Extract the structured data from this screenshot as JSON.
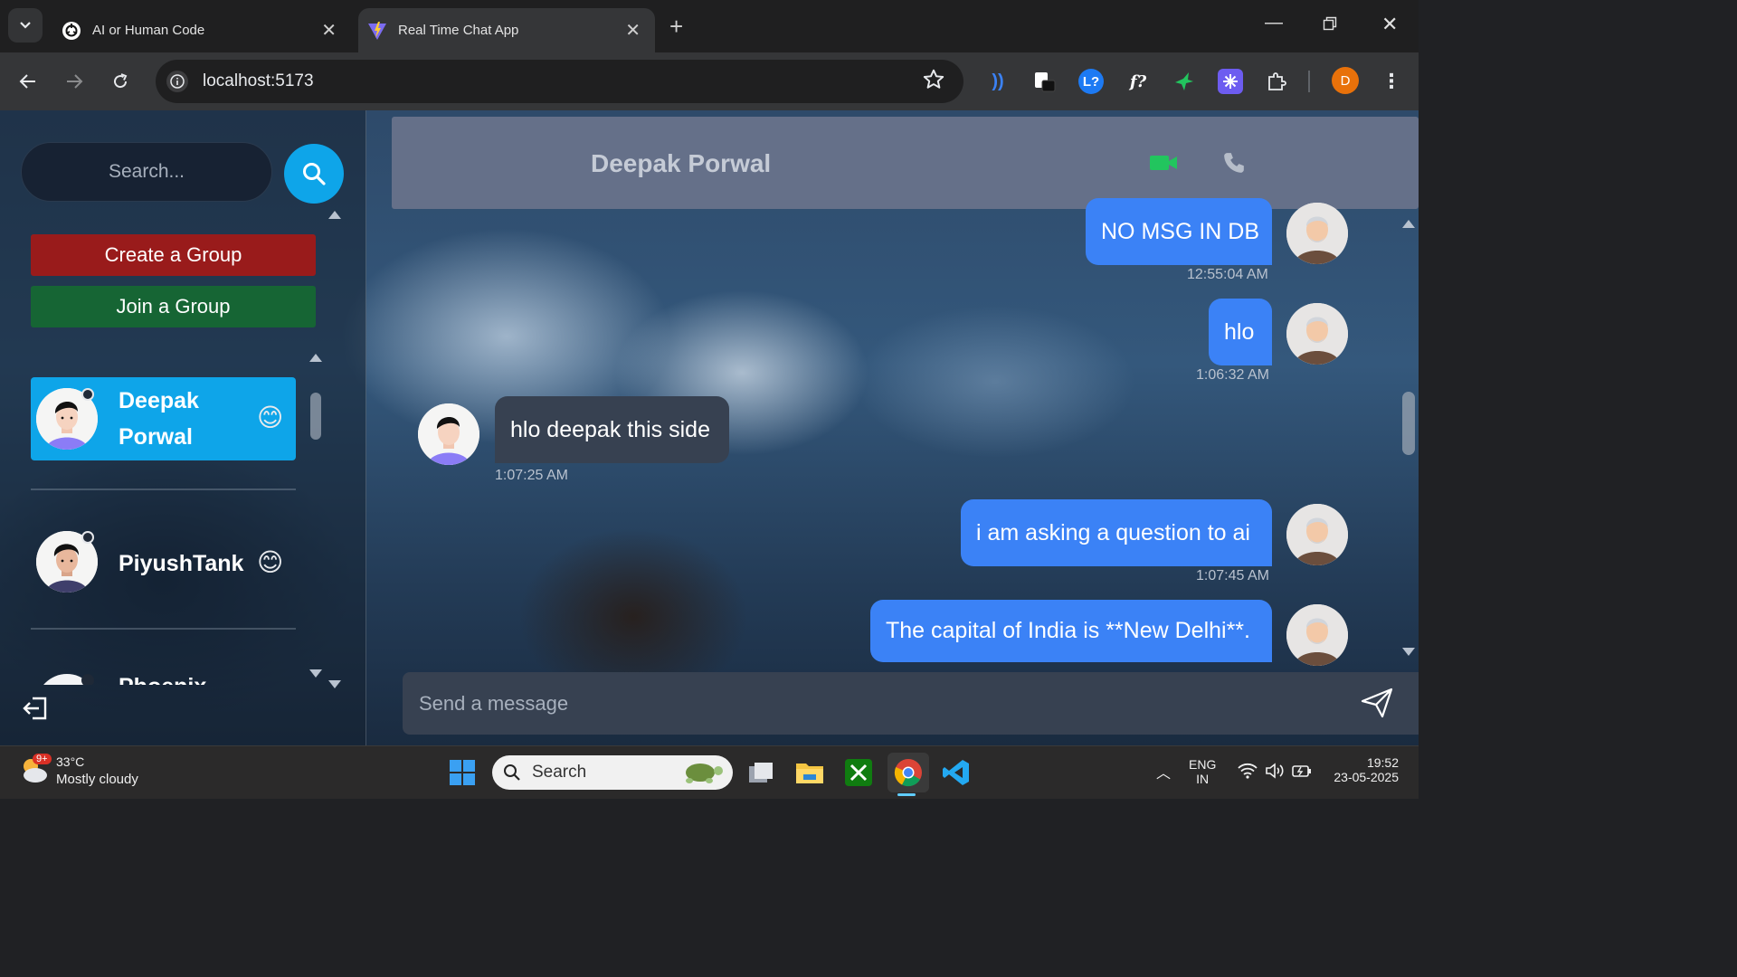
{
  "browser": {
    "tabs": [
      {
        "title": "AI or Human Code",
        "active": false
      },
      {
        "title": "Real Time Chat App",
        "active": true
      }
    ],
    "url": "localhost:5173",
    "profile_initial": "D",
    "extensions": [
      "wifi-signal-icon",
      "pip-icon",
      "l-question-icon",
      "f-question-icon",
      "bird-icon",
      "ai-sparkle-icon",
      "puzzle-icon"
    ]
  },
  "sidebar": {
    "search_placeholder": "Search...",
    "create_group_label": "Create a Group",
    "join_group_label": "Join a Group",
    "conversations": [
      {
        "name_line1": "Deepak",
        "name_line2": "Porwal",
        "emoji": "😊",
        "selected": true
      },
      {
        "name_line1": "PiyushTank",
        "name_line2": "",
        "emoji": "😊",
        "selected": false
      },
      {
        "name_line1": "Phoenix",
        "name_line2": "",
        "emoji": "",
        "selected": false
      }
    ]
  },
  "chat": {
    "contact_name": "Deepak Porwal",
    "messages": [
      {
        "text": "NO MSG IN DB",
        "time": "12:55:04 AM",
        "from_me": true
      },
      {
        "text": "hlo",
        "time": "1:06:32 AM",
        "from_me": true
      },
      {
        "text": "hlo deepak this side",
        "time": "1:07:25 AM",
        "from_me": false
      },
      {
        "text": "i am asking a question to ai",
        "time": "1:07:45 AM",
        "from_me": true
      },
      {
        "text": "The capital of India is **New Delhi**.",
        "time": "",
        "from_me": true
      }
    ],
    "composer_placeholder": "Send a message"
  },
  "taskbar": {
    "weather_badge": "9+",
    "temperature": "33°C",
    "weather": "Mostly cloudy",
    "search_label": "Search",
    "language_line1": "ENG",
    "language_line2": "IN",
    "time": "19:52",
    "date": "23-05-2025"
  },
  "colors": {
    "accent": "#0ea5e9",
    "create_group": "#991b1b",
    "join_group": "#166534",
    "sent_bubble": "#3b82f6",
    "received_bubble": "#374151"
  }
}
